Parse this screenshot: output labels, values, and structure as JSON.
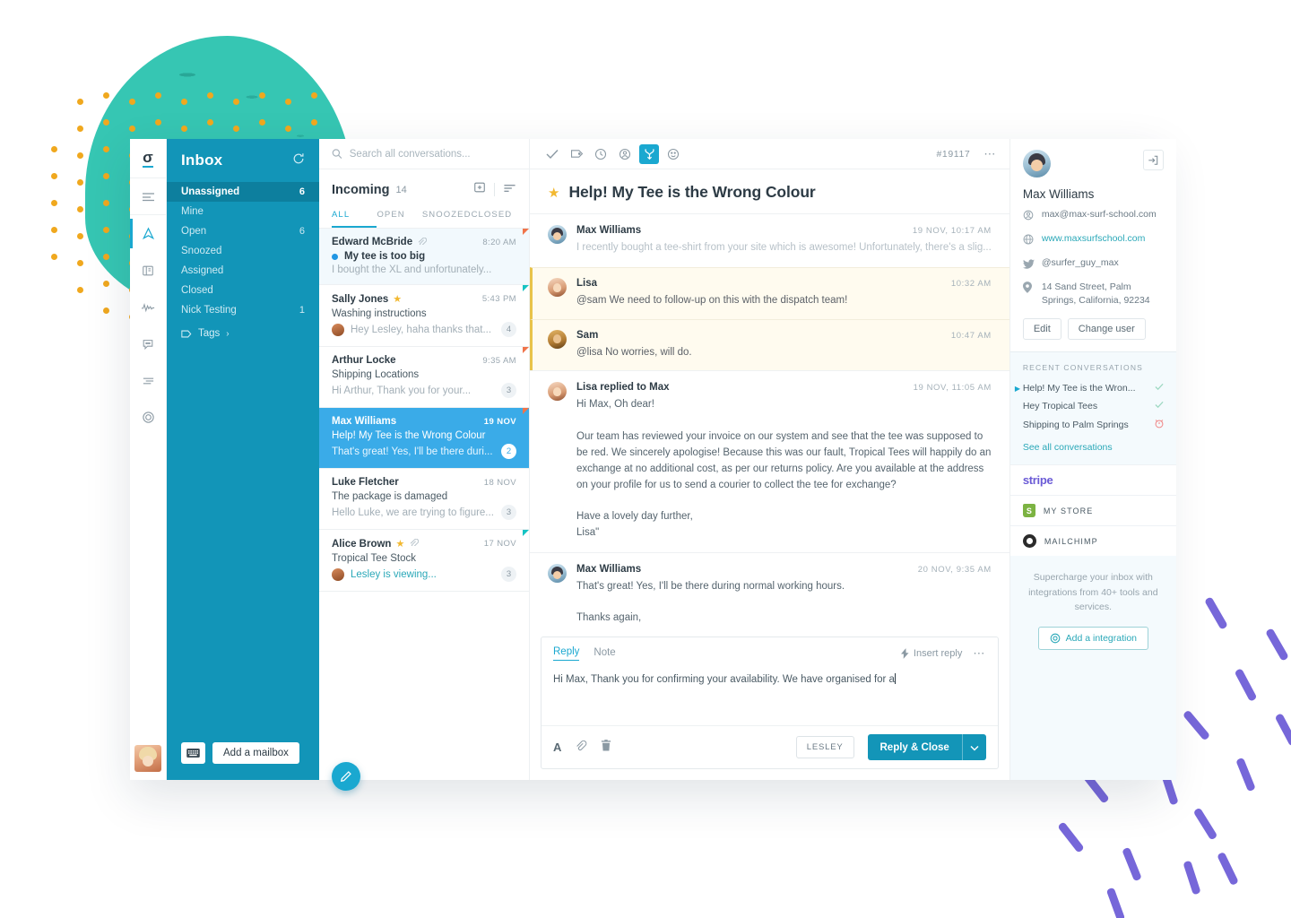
{
  "rail": {
    "logo": "σ",
    "items": [
      {
        "name": "menu-icon",
        "label": "Menu"
      },
      {
        "name": "inbox-icon",
        "label": "Inbox",
        "active": true
      },
      {
        "name": "docs-icon",
        "label": "Docs"
      },
      {
        "name": "reports-icon",
        "label": "Reports"
      },
      {
        "name": "chat-icon",
        "label": "Chat"
      },
      {
        "name": "settings-sliders-icon",
        "label": "Settings"
      },
      {
        "name": "target-icon",
        "label": "Beacon"
      }
    ]
  },
  "mailbox": {
    "title": "Inbox",
    "refresh_icon": "refresh-icon",
    "items": [
      {
        "label": "Unassigned",
        "count": "6",
        "active": true
      },
      {
        "label": "Mine",
        "count": "",
        "active": false
      },
      {
        "label": "Open",
        "count": "6",
        "active": false
      },
      {
        "label": "Snoozed",
        "count": "",
        "active": false
      },
      {
        "label": "Assigned",
        "count": "",
        "active": false
      },
      {
        "label": "Closed",
        "count": "",
        "active": false
      },
      {
        "label": "Nick Testing",
        "count": "1",
        "active": false
      }
    ],
    "tags_label": "Tags",
    "keyboard_icon": "keyboard-icon",
    "add_mailbox_label": "Add a mailbox"
  },
  "conversation_list": {
    "search_placeholder": "Search all conversations...",
    "folder_name": "Incoming",
    "folder_count": "14",
    "tabs": [
      {
        "label": "ALL",
        "active": true
      },
      {
        "label": "OPEN",
        "active": false
      },
      {
        "label": "SNOOZED",
        "active": false
      },
      {
        "label": "CLOSED",
        "active": false
      }
    ],
    "rows": [
      {
        "sender": "Edward McBride",
        "time": "8:20 AM",
        "subject": "My tee is too big",
        "preview": "I bought the XL and unfortunately...",
        "badge": "",
        "starred": false,
        "attachment": true,
        "unread": true,
        "selected": false,
        "corner": "orange",
        "avatar": false
      },
      {
        "sender": "Sally Jones",
        "time": "5:43 PM",
        "subject": "Washing instructions",
        "preview": "Hey Lesley, haha thanks that...",
        "badge": "4",
        "starred": true,
        "attachment": false,
        "unread": false,
        "selected": false,
        "corner": "teal",
        "avatar": true
      },
      {
        "sender": "Arthur Locke",
        "time": "9:35 AM",
        "subject": "Shipping Locations",
        "preview": "Hi Arthur, Thank you for your...",
        "badge": "3",
        "starred": false,
        "attachment": false,
        "unread": false,
        "selected": false,
        "corner": "orange",
        "avatar": false
      },
      {
        "sender": "Max Williams",
        "time": "19 NOV",
        "subject": "Help! My Tee is the Wrong Colour",
        "preview": "That's great! Yes, I'll be there duri...",
        "badge": "2",
        "starred": false,
        "attachment": false,
        "unread": false,
        "selected": true,
        "corner": "orange",
        "avatar": false
      },
      {
        "sender": "Luke Fletcher",
        "time": "18 NOV",
        "subject": "The package is damaged",
        "preview": "Hello Luke, we are trying to figure...",
        "badge": "3",
        "starred": false,
        "attachment": false,
        "unread": false,
        "selected": false,
        "corner": "",
        "avatar": false
      },
      {
        "sender": "Alice Brown",
        "time": "17 NOV",
        "subject": "Tropical Tee Stock",
        "preview": "Lesley is viewing...",
        "badge": "3",
        "starred": true,
        "attachment": true,
        "unread": false,
        "selected": false,
        "corner": "teal",
        "avatar": true,
        "viewing": true
      }
    ],
    "compose_icon": "pencil-icon"
  },
  "thread": {
    "toolbar": {
      "icons": [
        {
          "name": "check-icon",
          "active": false
        },
        {
          "name": "tag-icon",
          "active": false
        },
        {
          "name": "clock-icon",
          "active": false
        },
        {
          "name": "assign-user-icon",
          "active": false
        },
        {
          "name": "merge-icon",
          "active": true
        },
        {
          "name": "emoji-icon",
          "active": false
        }
      ],
      "number": "#19117",
      "more_icon": "more-options-icon"
    },
    "subject": "Help! My Tee is the Wrong Colour",
    "messages": [
      {
        "type": "collapsed",
        "avatar": "max",
        "name": "Max Williams",
        "time": "19 NOV, 10:17 AM",
        "text": "I recently bought a tee-shirt from your site which is awesome! Unfortunately, there's a slig..."
      },
      {
        "type": "note",
        "avatar": "lisa",
        "name": "Lisa",
        "time": "10:32 AM",
        "text": "@sam We need to follow-up on this with the dispatch team!"
      },
      {
        "type": "note",
        "avatar": "sam",
        "name": "Sam",
        "time": "10:47 AM",
        "text": "@lisa No worries, will do."
      },
      {
        "type": "message",
        "avatar": "lisa",
        "name": "Lisa replied to Max",
        "time": "19 NOV, 11:05 AM",
        "text": "Hi Max, Oh dear!\n\nOur team has reviewed your invoice on our system and see that the tee was supposed to be red. We sincerely apologise! Because this was our fault, Tropical Tees will happily do an exchange at no additional cost, as per our returns policy. Are you available at the address on your profile for us to send a courier to collect the tee for exchange?\n\nHave a lovely day further,\nLisa\""
      },
      {
        "type": "message",
        "avatar": "max",
        "name": "Max Williams",
        "time": "20 NOV, 9:35 AM",
        "text": "That's great! Yes, I'll be there during normal working hours.\n\nThanks again,\nMax"
      }
    ]
  },
  "composer": {
    "tabs": [
      {
        "label": "Reply",
        "active": true
      },
      {
        "label": "Note",
        "active": false
      }
    ],
    "insert_reply_label": "Insert reply",
    "more_icon": "more-options-icon",
    "draft_text": "Hi Max, Thank you for confirming your availability. We have organised for a",
    "tools": [
      {
        "name": "format-text-icon"
      },
      {
        "name": "attachment-icon"
      },
      {
        "name": "trash-icon"
      }
    ],
    "assignee_label": "LESLEY",
    "send_label": "Reply & Close",
    "send_caret_icon": "chevron-down-icon"
  },
  "right_panel": {
    "open_icon": "open-in-new-icon",
    "contact_name": "Max Williams",
    "fields": [
      {
        "icon": "person-icon",
        "value": "max@max-surf-school.com",
        "link": false
      },
      {
        "icon": "globe-icon",
        "value": "www.maxsurfschool.com",
        "link": true
      },
      {
        "icon": "twitter-icon",
        "value": "@surfer_guy_max",
        "link": false
      },
      {
        "icon": "location-pin-icon",
        "value": "14 Sand Street, Palm Springs, California, 92234",
        "link": false
      }
    ],
    "edit_label": "Edit",
    "change_user_label": "Change user",
    "recent_header": "RECENT CONVERSATIONS",
    "recent": [
      {
        "title": "Help! My Tee is the Wron...",
        "status": "check",
        "current": true
      },
      {
        "title": "Hey Tropical Tees",
        "status": "check",
        "current": false
      },
      {
        "title": "Shipping to Palm Springs",
        "status": "snooze",
        "current": false
      }
    ],
    "see_all_label": "See all conversations",
    "integrations": [
      {
        "name": "stripe",
        "label": "stripe",
        "type": "stripe"
      },
      {
        "name": "shopify",
        "label": "MY STORE",
        "type": "shop"
      },
      {
        "name": "mailchimp",
        "label": "MAILCHIMP",
        "type": "chimp"
      }
    ],
    "pitch": "Supercharge your inbox with integrations from 40+ tools and services.",
    "add_integration_label": "Add a integration",
    "add_integration_icon": "add-circle-icon"
  },
  "colors": {
    "brand_blue": "#1295b8",
    "accent_cyan": "#1aa8d0",
    "selected_row": "#3aabe8",
    "teal_blob": "#2ec4b0",
    "gold_dot": "#f0a81e",
    "purple_confetti": "#6a5ad6",
    "note_bg": "#fffbef",
    "note_border": "#e8c34a"
  }
}
